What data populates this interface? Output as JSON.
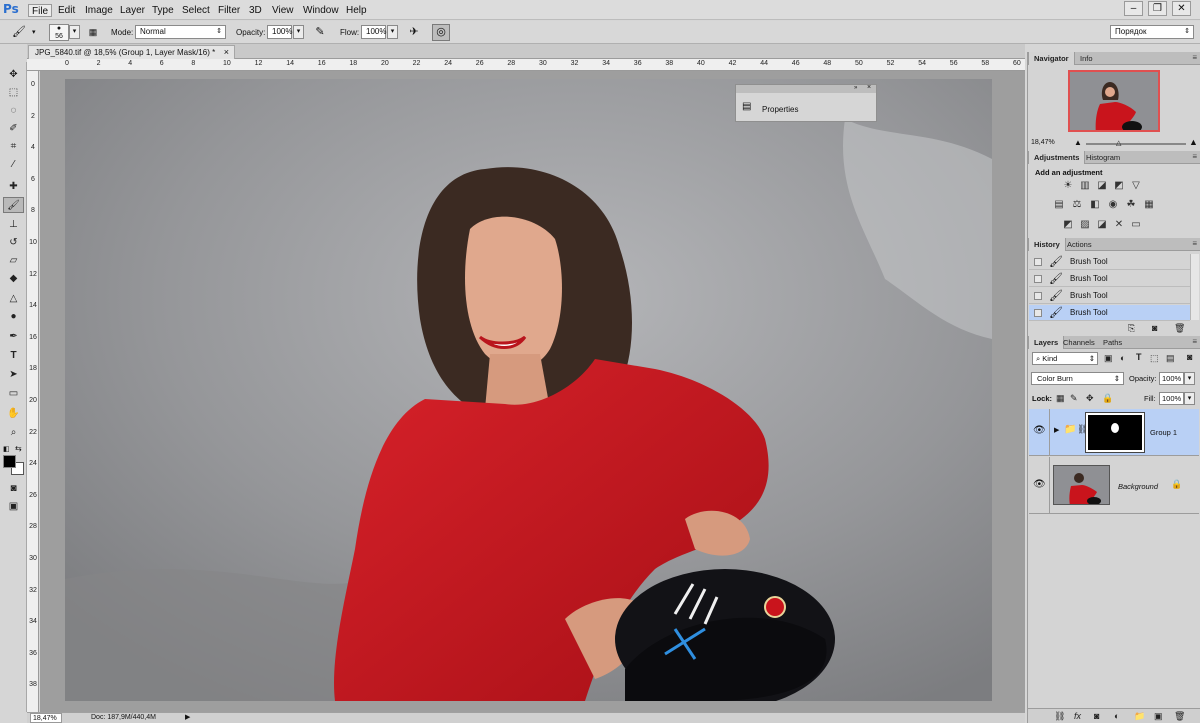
{
  "menubar": {
    "logo": "Ps",
    "items": [
      "File",
      "Edit",
      "Image",
      "Layer",
      "Type",
      "Select",
      "Filter",
      "3D",
      "View",
      "Window",
      "Help"
    ],
    "window_controls": [
      "–",
      "❐",
      "✕"
    ]
  },
  "options": {
    "brush_size": "56",
    "mode_label": "Mode:",
    "mode_value": "Normal",
    "opacity_label": "Opacity:",
    "opacity_value": "100%",
    "flow_label": "Flow:",
    "flow_value": "100%",
    "workspace_value": "Порядок"
  },
  "document": {
    "tab_title": "JPG_5840.tif @ 18,5% (Group 1, Layer Mask/16) *",
    "close": "×"
  },
  "rulers": {
    "h_ticks": [
      "0",
      "2",
      "4",
      "6",
      "8",
      "10",
      "12",
      "14",
      "16",
      "18",
      "20",
      "22",
      "24",
      "26",
      "28",
      "30",
      "32",
      "34",
      "36",
      "38",
      "40",
      "42",
      "44",
      "46",
      "48",
      "50",
      "52",
      "54",
      "56",
      "58",
      "60"
    ],
    "v_ticks": [
      "0",
      "2",
      "4",
      "6",
      "8",
      "10",
      "12",
      "14",
      "16",
      "18",
      "20",
      "22",
      "24",
      "26",
      "28",
      "30",
      "32",
      "34",
      "36",
      "38"
    ]
  },
  "properties_panel": {
    "title": "Properties"
  },
  "status": {
    "zoom": "18,47%",
    "doc": "Doc: 187,9M/440,4M"
  },
  "navigator": {
    "tabs": [
      "Navigator",
      "Info"
    ],
    "zoom": "18,47%"
  },
  "adjustments": {
    "tabs": [
      "Adjustments",
      "Histogram"
    ],
    "heading": "Add an adjustment"
  },
  "history": {
    "tabs": [
      "History",
      "Actions"
    ],
    "items": [
      "Brush Tool",
      "Brush Tool",
      "Brush Tool",
      "Brush Tool"
    ]
  },
  "layers": {
    "tabs": [
      "Layers",
      "Channels",
      "Paths"
    ],
    "filter_value": "Kind",
    "blend_mode": "Color Burn",
    "opacity_label": "Opacity:",
    "opacity_value": "100%",
    "lock_label": "Lock:",
    "fill_label": "Fill:",
    "fill_value": "100%",
    "items": [
      {
        "name": "Group 1"
      },
      {
        "name": "Background"
      }
    ]
  },
  "colors": {
    "accent_blue": "#2b6fcf",
    "selected_row": "#b9d0f5",
    "dress_red": "#c9141c",
    "wall_grey": "#8b8b8d"
  }
}
